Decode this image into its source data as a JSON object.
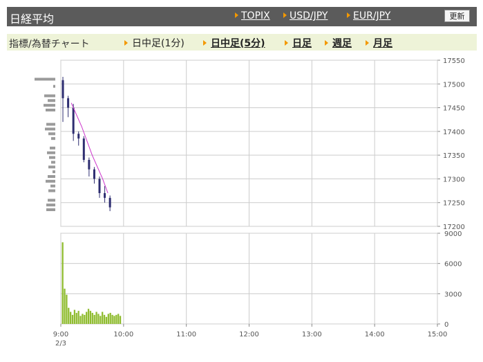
{
  "header": {
    "title": "日経平均",
    "links": [
      "TOPIX",
      "USD/JPY",
      "EUR/JPY"
    ],
    "refresh_label": "更新"
  },
  "tabs": {
    "label": "指標/為替チャート",
    "items": [
      {
        "label": "日中足(1分)",
        "active": true
      },
      {
        "label": "日中足(5分)",
        "active": false
      },
      {
        "label": "日足",
        "active": false
      },
      {
        "label": "週足",
        "active": false
      },
      {
        "label": "月足",
        "active": false
      }
    ]
  },
  "chart_data": {
    "type": "candlestick",
    "time_labels": [
      "9:00",
      "10:00",
      "11:00",
      "12:00",
      "13:00",
      "14:00",
      "15:00"
    ],
    "date_label": "2/3",
    "price_ticks": [
      17550,
      17500,
      17450,
      17400,
      17350,
      17300,
      17250,
      17200
    ],
    "price_ylim": [
      17200,
      17550
    ],
    "volume_ticks": [
      9000,
      6000,
      3000,
      0
    ],
    "volume_ylim": [
      0,
      9000
    ],
    "candles_5min": [
      {
        "t": "9:00",
        "open": 17508,
        "high": 17515,
        "low": 17420,
        "close": 17470
      },
      {
        "t": "9:05",
        "open": 17470,
        "high": 17475,
        "low": 17430,
        "close": 17450
      },
      {
        "t": "9:10",
        "open": 17450,
        "high": 17458,
        "low": 17380,
        "close": 17395
      },
      {
        "t": "9:15",
        "open": 17395,
        "high": 17400,
        "low": 17370,
        "close": 17385
      },
      {
        "t": "9:20",
        "open": 17385,
        "high": 17390,
        "low": 17335,
        "close": 17340
      },
      {
        "t": "9:25",
        "open": 17340,
        "high": 17345,
        "low": 17305,
        "close": 17320
      },
      {
        "t": "9:30",
        "open": 17320,
        "high": 17325,
        "low": 17290,
        "close": 17300
      },
      {
        "t": "9:35",
        "open": 17300,
        "high": 17305,
        "low": 17260,
        "close": 17270
      },
      {
        "t": "9:40",
        "open": 17270,
        "high": 17285,
        "low": 17250,
        "close": 17260
      },
      {
        "t": "9:45",
        "open": 17260,
        "high": 17265,
        "low": 17232,
        "close": 17240
      }
    ],
    "moving_average": [
      {
        "t": "9:10",
        "v": 17460
      },
      {
        "t": "9:20",
        "v": 17410
      },
      {
        "t": "9:30",
        "v": 17350
      },
      {
        "t": "9:40",
        "v": 17300
      },
      {
        "t": "9:45",
        "v": 17270
      }
    ],
    "volume_bars": [
      8100,
      3500,
      2900,
      1600,
      1200,
      900,
      1400,
      1100,
      1300,
      800,
      1000,
      900,
      1200,
      1500,
      1300,
      1100,
      900,
      1200,
      1000,
      800,
      1200,
      900,
      700,
      1000,
      1100,
      900,
      800,
      900,
      1000,
      800
    ],
    "price_profile": [
      {
        "p": 17510,
        "w": 60
      },
      {
        "p": 17495,
        "w": 6
      },
      {
        "p": 17475,
        "w": 32
      },
      {
        "p": 17465,
        "w": 22
      },
      {
        "p": 17455,
        "w": 34
      },
      {
        "p": 17445,
        "w": 28
      },
      {
        "p": 17415,
        "w": 26
      },
      {
        "p": 17405,
        "w": 30
      },
      {
        "p": 17395,
        "w": 20
      },
      {
        "p": 17385,
        "w": 12
      },
      {
        "p": 17365,
        "w": 16
      },
      {
        "p": 17355,
        "w": 24
      },
      {
        "p": 17345,
        "w": 18
      },
      {
        "p": 17335,
        "w": 12
      },
      {
        "p": 17325,
        "w": 20
      },
      {
        "p": 17315,
        "w": 8
      },
      {
        "p": 17305,
        "w": 22
      },
      {
        "p": 17295,
        "w": 28
      },
      {
        "p": 17285,
        "w": 14
      },
      {
        "p": 17275,
        "w": 20
      },
      {
        "p": 17255,
        "w": 22
      },
      {
        "p": 17245,
        "w": 26
      },
      {
        "p": 17235,
        "w": 26
      }
    ],
    "colors": {
      "grid": "#cccccc",
      "candle_up": "#6b6ad0",
      "candle_down": "#2d2d70",
      "ma_line": "#cc33cc",
      "volume": "#8fbc2f",
      "profile": "#9a9a9a"
    }
  }
}
